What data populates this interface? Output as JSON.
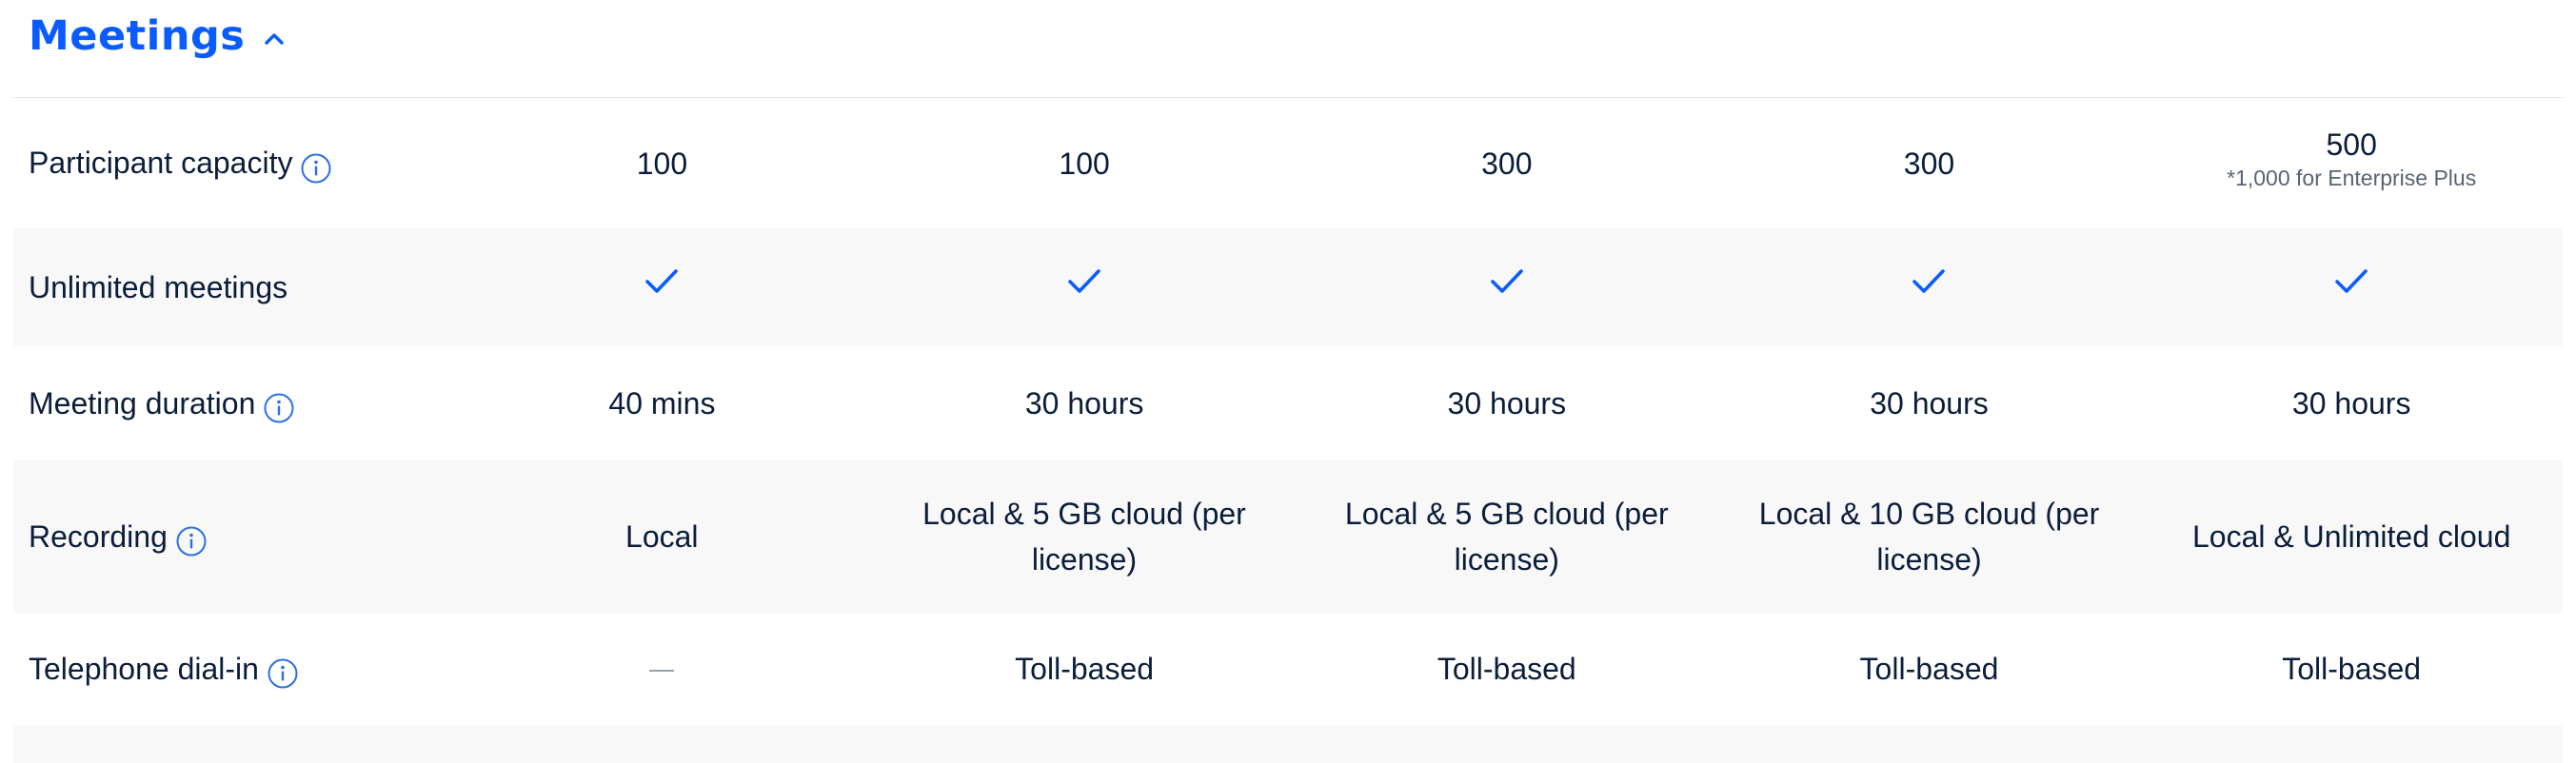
{
  "section": {
    "title": "Meetings",
    "colors": {
      "title": "#0b5cff",
      "check": "#0b5cff",
      "info": "#2d6fe0"
    }
  },
  "rows": [
    {
      "label": "Participant capacity",
      "has_info": true,
      "cells": [
        {
          "text": "100"
        },
        {
          "text": "100"
        },
        {
          "text": "300"
        },
        {
          "text": "300"
        },
        {
          "text": "500",
          "sub": "*1,000 for Enterprise Plus"
        }
      ]
    },
    {
      "label": "Unlimited meetings",
      "has_info": false,
      "cells": [
        {
          "icon": "checkmark-icon"
        },
        {
          "icon": "checkmark-icon"
        },
        {
          "icon": "checkmark-icon"
        },
        {
          "icon": "checkmark-icon"
        },
        {
          "icon": "checkmark-icon"
        }
      ]
    },
    {
      "label": "Meeting duration",
      "has_info": true,
      "cells": [
        {
          "text": "40 mins"
        },
        {
          "text": "30 hours"
        },
        {
          "text": "30 hours"
        },
        {
          "text": "30 hours"
        },
        {
          "text": "30 hours"
        }
      ]
    },
    {
      "label": "Recording",
      "has_info": true,
      "cells": [
        {
          "text": "Local"
        },
        {
          "text": "Local & 5 GB cloud (per license)"
        },
        {
          "text": "Local & 5 GB cloud (per license)"
        },
        {
          "text": "Local & 10 GB cloud (per license)"
        },
        {
          "text": "Local & Unlimited cloud"
        }
      ]
    },
    {
      "label": "Telephone dial-in",
      "has_info": true,
      "cells": [
        {
          "icon": "dash-icon"
        },
        {
          "text": "Toll-based"
        },
        {
          "text": "Toll-based"
        },
        {
          "text": "Toll-based"
        },
        {
          "text": "Toll-based"
        }
      ]
    }
  ]
}
